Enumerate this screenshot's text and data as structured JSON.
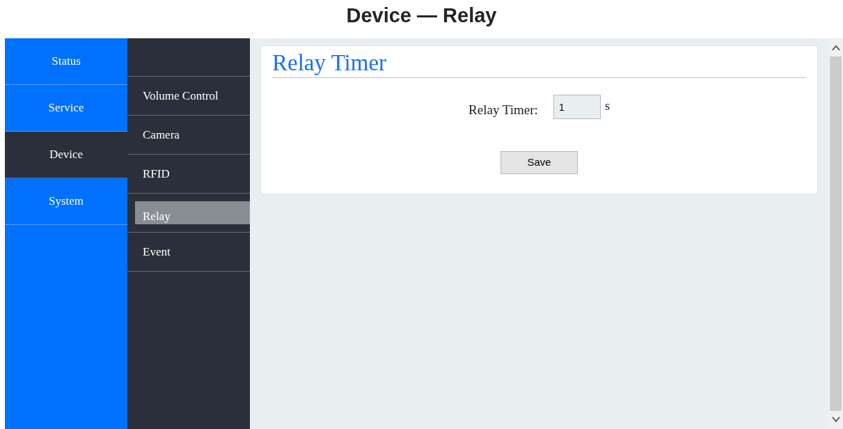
{
  "page_title": "Device — Relay",
  "main_nav": [
    {
      "label": "Status",
      "selected": false
    },
    {
      "label": "Service",
      "selected": false
    },
    {
      "label": "Device",
      "selected": true
    },
    {
      "label": "System",
      "selected": false
    }
  ],
  "sub_nav": [
    {
      "label": "Volume Control",
      "selected": false
    },
    {
      "label": "Camera",
      "selected": false
    },
    {
      "label": "RFID",
      "selected": false
    },
    {
      "label": "Relay",
      "selected": true
    },
    {
      "label": "Event",
      "selected": false
    }
  ],
  "panel": {
    "title": "Relay Timer",
    "field": {
      "label": "Relay Timer:",
      "value": "1",
      "unit": "s"
    },
    "button": "Save"
  }
}
